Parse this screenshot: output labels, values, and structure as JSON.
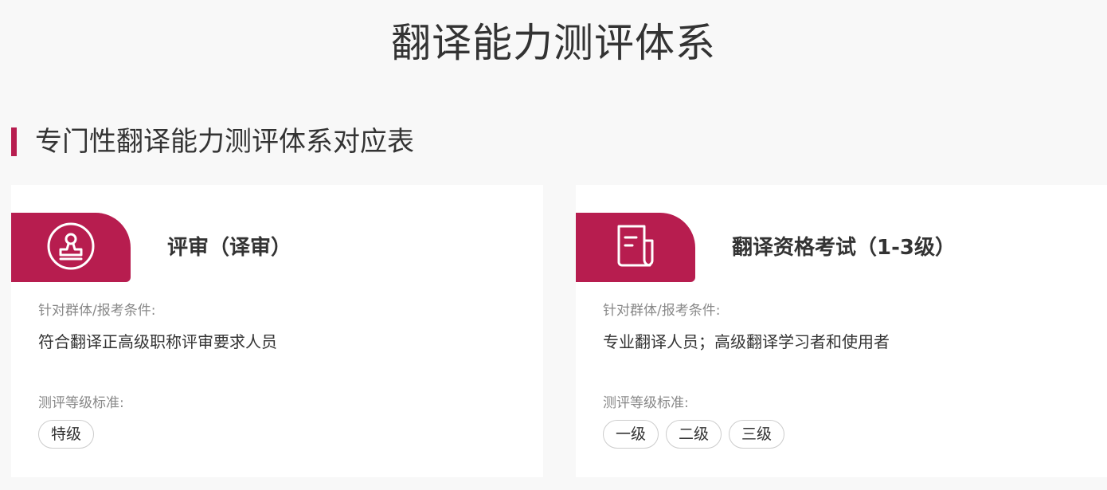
{
  "page": {
    "title": "翻译能力测评体系"
  },
  "section": {
    "heading": "专门性翻译能力测评体系对应表"
  },
  "colors": {
    "accent": "#b71d4f",
    "background": "#f8f8f8",
    "card": "#ffffff",
    "text": "#333333",
    "muted": "#888888"
  },
  "cards": [
    {
      "icon": "stamp-icon",
      "title": "评审（译审）",
      "target_label": "针对群体/报考条件:",
      "target_value": "符合翻译正高级职称评审要求人员",
      "level_label": "测评等级标准:",
      "levels": [
        "特级"
      ]
    },
    {
      "icon": "document-icon",
      "title": "翻译资格考试（1-3级）",
      "target_label": "针对群体/报考条件:",
      "target_value": "专业翻译人员；高级翻译学习者和使用者",
      "level_label": "测评等级标准:",
      "levels": [
        "一级",
        "二级",
        "三级"
      ]
    }
  ]
}
